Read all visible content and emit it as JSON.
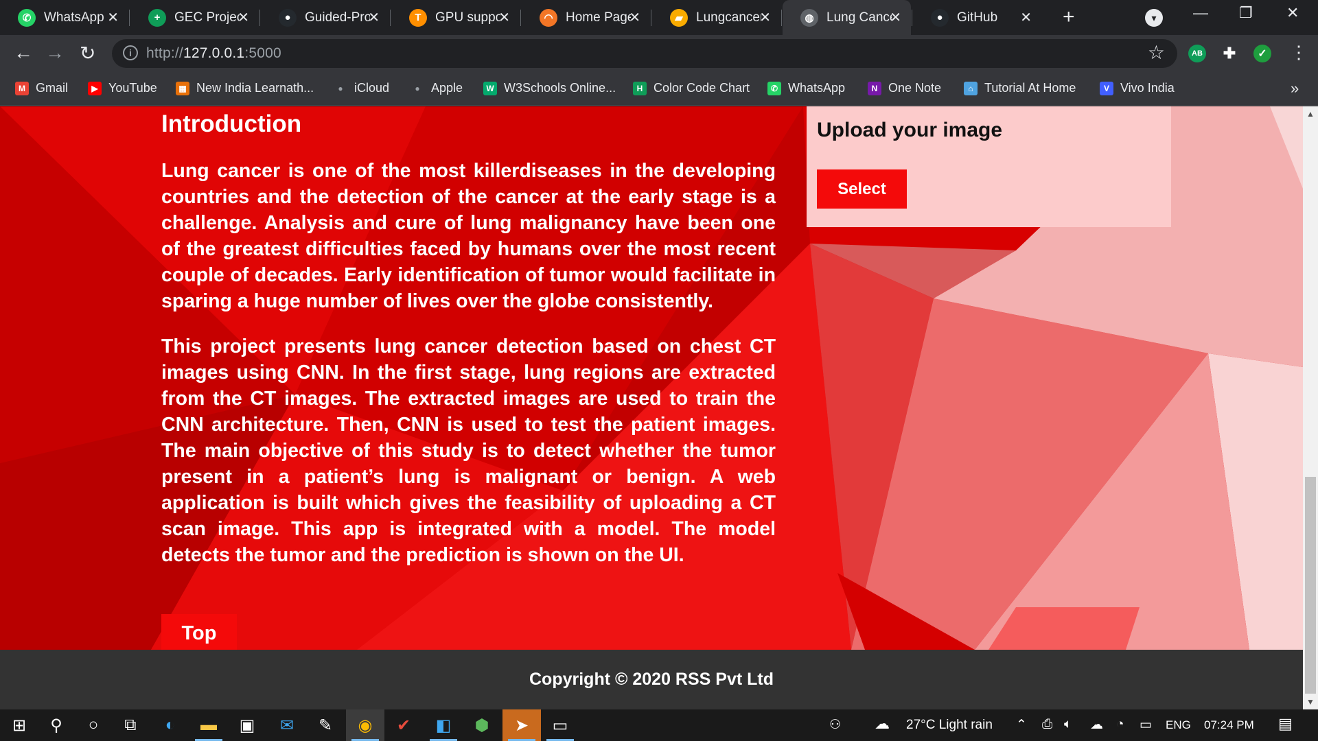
{
  "browser": {
    "tabs": [
      {
        "label": "WhatsApp",
        "icon": "whatsapp-icon",
        "color": "#25d366",
        "glyph": "✆"
      },
      {
        "label": "GEC Project",
        "icon": "sheets-icon",
        "color": "#0f9d58",
        "glyph": "+"
      },
      {
        "label": "Guided-Proj",
        "icon": "github-icon",
        "color": "#24292e",
        "glyph": "●"
      },
      {
        "label": "GPU suppor",
        "icon": "tensorflow-icon",
        "color": "#ff8f00",
        "glyph": "T"
      },
      {
        "label": "Home Page",
        "icon": "jupyter-icon",
        "color": "#f37626",
        "glyph": "◠"
      },
      {
        "label": "Lungcancer",
        "icon": "colab-icon",
        "color": "#f9ab00",
        "glyph": "▰"
      },
      {
        "label": "Lung Cance",
        "icon": "globe-icon",
        "color": "#5f6368",
        "glyph": "◍",
        "active": true
      },
      {
        "label": "GitHub",
        "icon": "github-icon",
        "color": "#24292e",
        "glyph": "●"
      }
    ],
    "url": {
      "scheme": "http://",
      "host": "127.0.0.1",
      "port": ":5000"
    },
    "bookmarks": [
      {
        "label": "Gmail",
        "icon": "gmail-icon",
        "color": "#ea4335",
        "glyph": "M"
      },
      {
        "label": "YouTube",
        "icon": "youtube-icon",
        "color": "#ff0000",
        "glyph": "▶"
      },
      {
        "label": "New India Learnath...",
        "icon": "bookmark-site-icon",
        "color": "#e8710a",
        "glyph": "▦"
      },
      {
        "label": "iCloud",
        "icon": "apple-icon",
        "color": "#9aa0a6",
        "glyph": ""
      },
      {
        "label": "Apple",
        "icon": "apple-icon",
        "color": "#9aa0a6",
        "glyph": ""
      },
      {
        "label": "W3Schools Online...",
        "icon": "w3schools-icon",
        "color": "#04aa6d",
        "glyph": "W"
      },
      {
        "label": "Color Code Chart",
        "icon": "htmlcolor-icon",
        "color": "#0f9d58",
        "glyph": "H"
      },
      {
        "label": "WhatsApp",
        "icon": "whatsapp-icon",
        "color": "#25d366",
        "glyph": "✆"
      },
      {
        "label": "One Note",
        "icon": "onenote-icon",
        "color": "#7719aa",
        "glyph": "N"
      },
      {
        "label": "Tutorial At Home",
        "icon": "home-icon",
        "color": "#4fa3e0",
        "glyph": "⌂"
      },
      {
        "label": "Vivo India",
        "icon": "vivo-icon",
        "color": "#415fff",
        "glyph": "V"
      }
    ]
  },
  "page": {
    "intro_heading": "Introduction",
    "para1": "Lung cancer is one of the most killerdiseases in the developing countries and the detection of the cancer at the early stage is a challenge. Analysis and cure of lung malignancy have been one of the greatest difficulties faced by humans over the most recent couple of decades. Early identification of tumor would facilitate in sparing a huge number of lives over the globe consistently.",
    "para2": "This project presents lung cancer detection based on chest CT images using CNN. In the first stage, lung regions are extracted from the CT images. The extracted images are used to train the CNN architecture. Then, CNN is used to test the patient images. The main objective of this study is to detect whether the tumor present in a patient’s lung is malignant or benign. A web application is built which gives the feasibility of uploading a CT scan image. This app is integrated with a model. The model detects the tumor and the prediction is shown on the UI.",
    "top_button": "Top",
    "upload_title": "Upload your image",
    "select_button": "Select",
    "copyright": "Copyright © 2020 RSS Pvt Ltd",
    "accent_color": "#f40a0a"
  },
  "taskbar": {
    "weather": "27°C  Light rain",
    "language": "ENG",
    "time": "07:24 PM"
  }
}
